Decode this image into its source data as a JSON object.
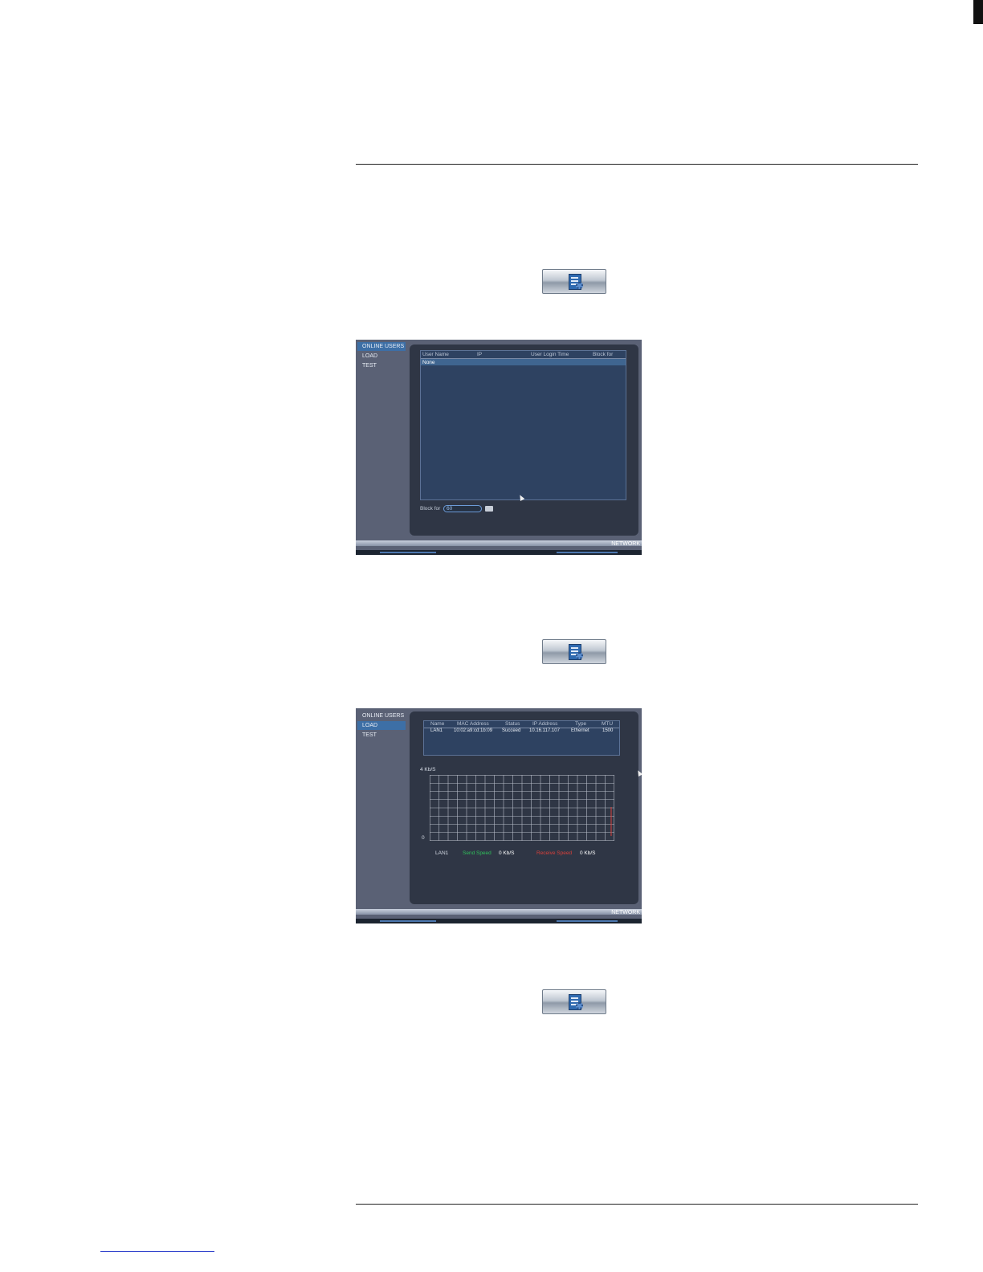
{
  "screens": [
    {
      "menu": [
        "ONLINE USERS",
        "LOAD",
        "TEST"
      ],
      "active_menu": 0,
      "users_table": {
        "headers": [
          "User Name",
          "IP",
          "User Login Time",
          "Block for"
        ],
        "rows": [
          [
            "None",
            "",
            "",
            ""
          ]
        ]
      },
      "block_for": {
        "label": "Block for",
        "value": "60"
      },
      "footer": "NETWORK"
    },
    {
      "menu": [
        "ONLINE USERS",
        "LOAD",
        "TEST"
      ],
      "active_menu": 1,
      "load_table": {
        "headers": [
          "Name",
          "MAC Address",
          "Status",
          "IP Address",
          "Type",
          "MTU"
        ],
        "rows": [
          [
            "LAN1",
            "10:02:a9:cd:1b:09",
            "Succeed",
            "10.16.117.107",
            "Ethernet",
            "1500"
          ]
        ]
      },
      "graph": {
        "y_max_label": "4 Kb/S",
        "y_min_label": "0"
      },
      "legend": {
        "interface": "LAN1",
        "send_label": "Send Speed",
        "send_value": "0 Kb/S",
        "receive_label": "Receive Speed",
        "receive_value": "0 Kb/S"
      },
      "footer": "NETWORK"
    }
  ],
  "colors": {
    "send": "#2fbf5a",
    "receive": "#d9403a",
    "active_menu": "#3d6fa6"
  },
  "icons": [
    "setup-button-icon",
    "document-gear-icon",
    "cursor-icon"
  ]
}
